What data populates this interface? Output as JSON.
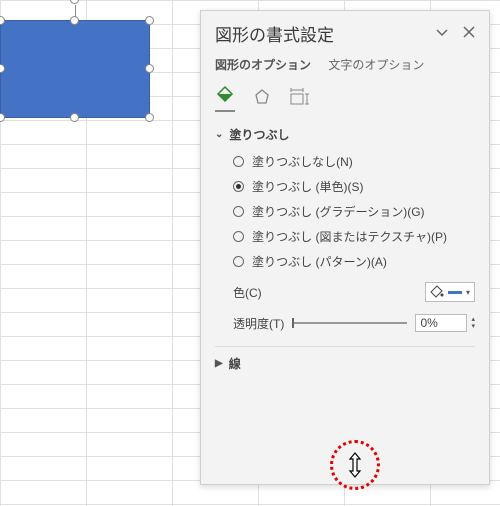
{
  "pane": {
    "title": "図形の書式設定",
    "tabs": {
      "shape": "図形のオプション",
      "text": "文字のオプション"
    }
  },
  "sections": {
    "fill": "塗りつぶし",
    "line": "線"
  },
  "fillOptions": {
    "none": "塗りつぶしなし(N)",
    "solid": "塗りつぶし (単色)(S)",
    "grad": "塗りつぶし (グラデーション)(G)",
    "tex": "塗りつぶし (図またはテクスチャ)(P)",
    "pat": "塗りつぶし (パターン)(A)"
  },
  "labels": {
    "color": "色(C)",
    "transparency": "透明度(T)"
  },
  "values": {
    "transparency": "0%"
  }
}
